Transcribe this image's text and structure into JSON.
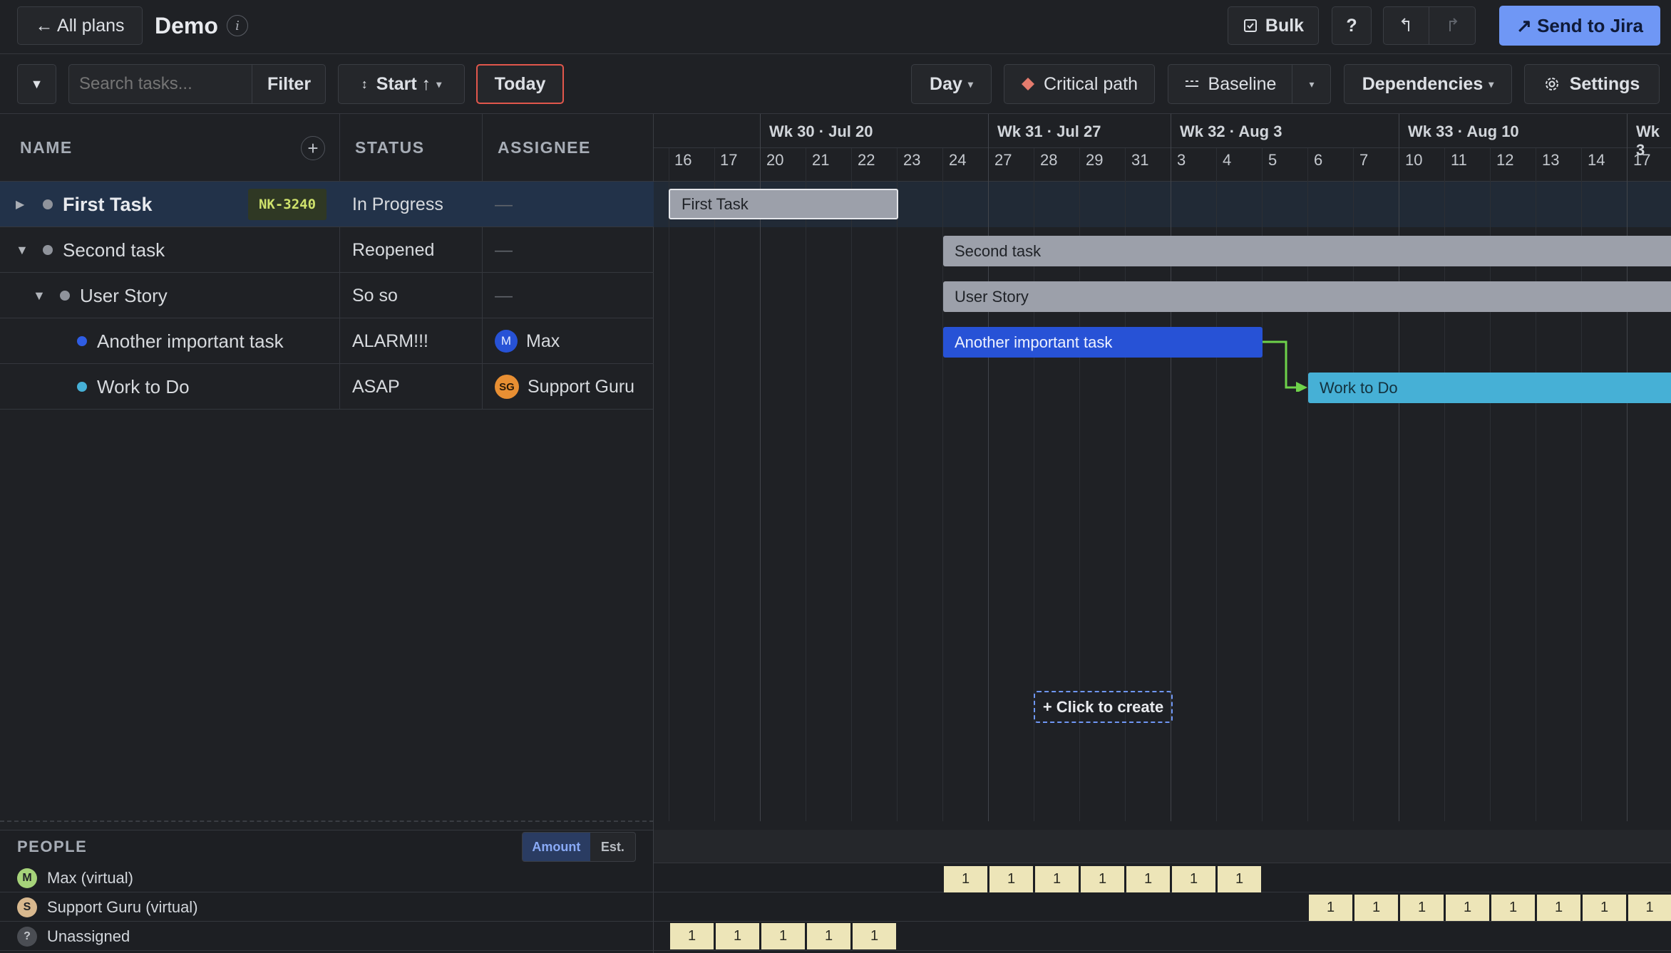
{
  "header": {
    "back_label": "← All plans",
    "title": "Demo",
    "info_icon": "i",
    "bulk_label": "Bulk",
    "help_label": "?",
    "undo_icon": "undo-icon",
    "redo_icon": "redo-icon",
    "send_label": "↗ Send to Jira"
  },
  "toolbar": {
    "collapse_icon": "▼",
    "search_placeholder": "Search tasks...",
    "filter_label": "Filter",
    "sort_label": "Start ↑",
    "today_label": "Today",
    "day_label": "Day",
    "critical_label": "Critical path",
    "baseline_label": "Baseline",
    "dependencies_label": "Dependencies",
    "settings_label": "Settings"
  },
  "columns": {
    "name": "NAME",
    "status": "STATUS",
    "assignee": "ASSIGNEE"
  },
  "rows": [
    {
      "name": "First Task",
      "key": "NK-3240",
      "status": "In Progress",
      "assignee": "—",
      "initials": "",
      "toggle": "▶"
    },
    {
      "name": "Second task",
      "key": "",
      "status": "Reopened",
      "assignee": "—",
      "initials": "",
      "toggle": "▼"
    },
    {
      "name": "User Story",
      "key": "",
      "status": "So so",
      "assignee": "—",
      "initials": "",
      "toggle": "▼"
    },
    {
      "name": "Another important task",
      "key": "",
      "status": "ALARM!!!",
      "assignee": "Max",
      "initials": "M",
      "toggle": ""
    },
    {
      "name": "Work to Do",
      "key": "",
      "status": "ASAP",
      "assignee": "Support Guru",
      "initials": "SG",
      "toggle": ""
    }
  ],
  "timeline": {
    "weeks": [
      "Wk 30 · Jul 20",
      "Wk 31 · Jul 27",
      "Wk 32 · Aug 3",
      "Wk 33 · Aug 10",
      "Wk 3"
    ],
    "days": [
      "16",
      "17",
      "20",
      "21",
      "22",
      "23",
      "24",
      "27",
      "28",
      "29",
      "31",
      "3",
      "4",
      "5",
      "6",
      "7",
      "10",
      "11",
      "12",
      "13",
      "14",
      "17"
    ],
    "bars": [
      "First Task",
      "Second task",
      "User Story",
      "Another important task",
      "Work to Do"
    ],
    "click_create": "+ Click to create"
  },
  "people": {
    "title": "PEOPLE",
    "toggle_amount": "Amount",
    "toggle_est": "Est.",
    "rows": [
      {
        "initial": "M",
        "name": "Max (virtual)",
        "color": "#a6d37a",
        "values": [
          "1",
          "1",
          "1",
          "1",
          "1",
          "1",
          "1"
        ]
      },
      {
        "initial": "S",
        "name": "Support Guru (virtual)",
        "color": "#d8b88e",
        "values": [
          "1",
          "1",
          "1",
          "1",
          "1",
          "1",
          "1",
          "1"
        ]
      },
      {
        "initial": "?",
        "name": "Unassigned",
        "color": "#4a4d53",
        "values": [
          "1",
          "1",
          "1",
          "1",
          "1"
        ]
      }
    ]
  },
  "colors": {
    "accent": "#6f97f5",
    "today_border": "#e2574c",
    "bar_gray": "#9ca0aa",
    "bar_blue": "#2752d6",
    "bar_cyan": "#46b0d6",
    "dependency": "#6ed24a",
    "key_badge_text": "#cfe26c"
  }
}
